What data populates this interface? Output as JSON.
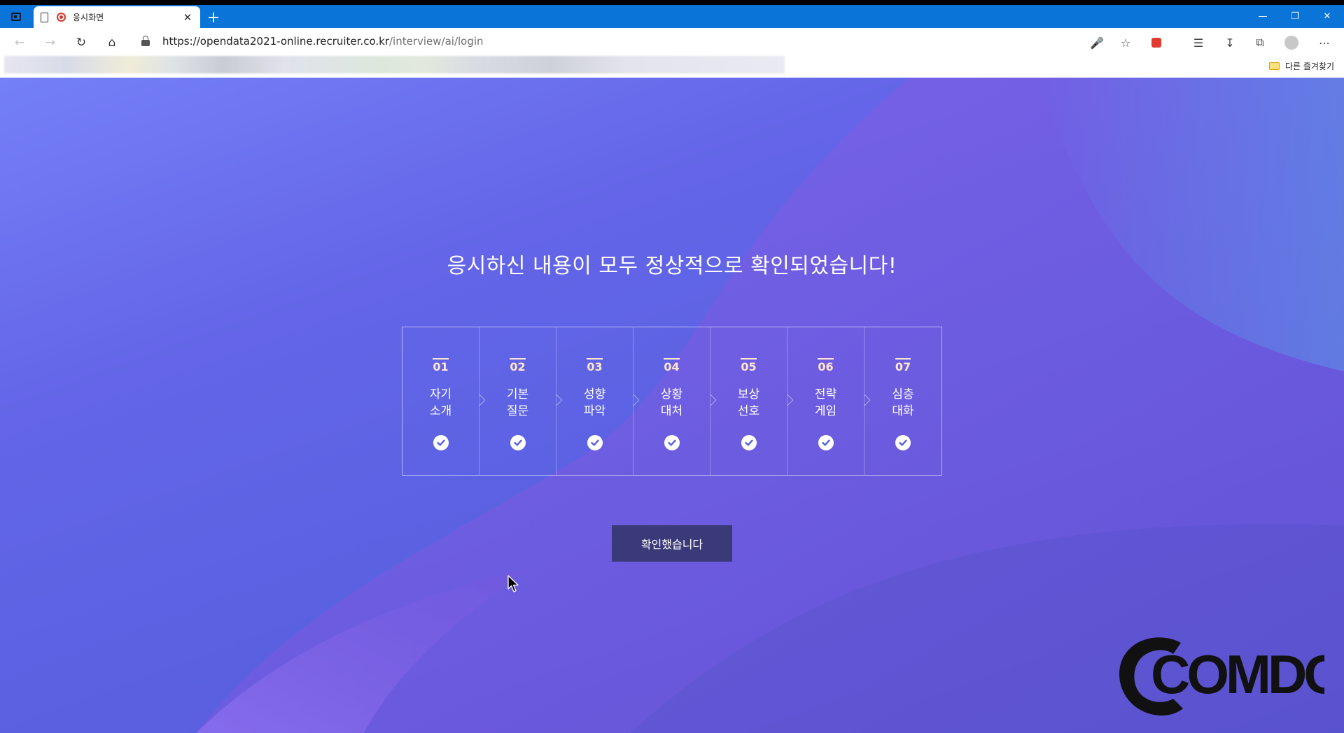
{
  "browser": {
    "tab": {
      "title": "응시화면"
    },
    "address": {
      "url_host": "https://opendata2021-online.recruiter.co.kr",
      "url_path": "/interview/ai/login"
    },
    "favorites": {
      "folder_label": "다른 즐겨찾기"
    }
  },
  "page": {
    "heading": "응시하신 내용이 모두 정상적으로 확인되었습니다!",
    "steps": [
      {
        "num": "01",
        "label": "자기\n소개",
        "done": true
      },
      {
        "num": "02",
        "label": "기본\n질문",
        "done": true
      },
      {
        "num": "03",
        "label": "성향\n파악",
        "done": true
      },
      {
        "num": "04",
        "label": "상황\n대처",
        "done": true
      },
      {
        "num": "05",
        "label": "보상\n선호",
        "done": true
      },
      {
        "num": "06",
        "label": "전략\n게임",
        "done": true
      },
      {
        "num": "07",
        "label": "심층\n대화",
        "done": true
      }
    ],
    "confirm_label": "확인했습니다",
    "watermark": "COMDORI"
  },
  "colors": {
    "tabbar": "#0a74d8",
    "button": "#3b3a78",
    "step_number": "#ffe6cf"
  }
}
